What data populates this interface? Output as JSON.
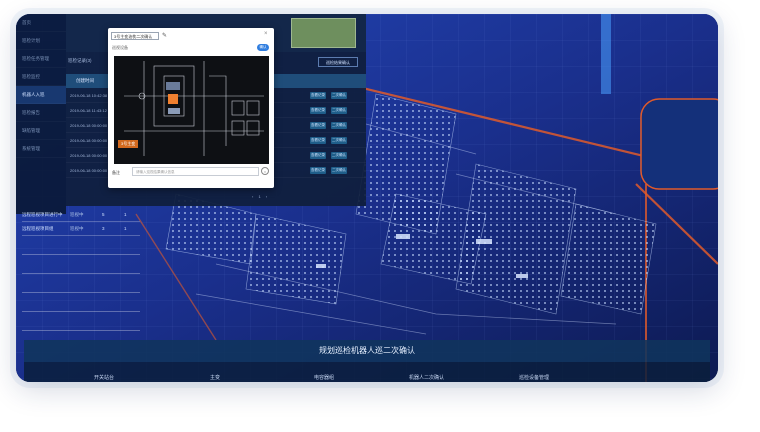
{
  "sidebar": {
    "items": [
      {
        "label": "首页",
        "active": false
      },
      {
        "label": "巡检计划",
        "active": false
      },
      {
        "label": "巡检任务管理",
        "active": false
      },
      {
        "label": "巡检监控",
        "active": false
      },
      {
        "label": "机器人入巡",
        "active": true
      },
      {
        "label": "巡检报告",
        "active": false
      },
      {
        "label": "缺陷管理",
        "active": false
      },
      {
        "label": "系统管理",
        "active": false
      }
    ]
  },
  "background_panel": {
    "section_title": "巡检记录(3)",
    "section_button": "巡检结果确认",
    "table_header": "创建时间",
    "rows": [
      {
        "time": "2019-06-18 10:42:38",
        "btn1": "查看记录",
        "btn2": "二次确认"
      },
      {
        "time": "2019-06-18 11:43:12",
        "btn1": "查看记录",
        "btn2": "二次确认"
      },
      {
        "time": "2019-06-18 00:00:00",
        "btn1": "查看记录",
        "btn2": "二次确认"
      },
      {
        "time": "2019-06-18 00:00:00",
        "btn1": "查看记录",
        "btn2": "二次确认"
      },
      {
        "time": "2019-06-18 00:00:00",
        "btn1": "查看记录",
        "btn2": "二次确认"
      },
      {
        "time": "2019-06-18 00:00:00",
        "btn1": "查看记录",
        "btn2": "二次确认"
      }
    ],
    "pager": "‹ 1 ›"
  },
  "left_list": [
    {
      "name": "远程巡视项目进行中",
      "status": "巡视中",
      "a": "5",
      "b": "1"
    },
    {
      "name": "远程巡视项目组",
      "status": "巡视中",
      "a": "3",
      "b": "1"
    }
  ],
  "dialog": {
    "select_value": "3号主变油枕二次确认",
    "subtitle": "巡视设备",
    "confirm_button": "确认",
    "image_tag": "3号主变",
    "footer_label": "备注",
    "footer_placeholder": "请输入巡视结果确认信息"
  },
  "bottom_bar": {
    "title": "规划巡检机器人巡二次确认",
    "labels": [
      "开关站台",
      "主变",
      "电容器组",
      "机器人二次确认",
      "巡检设备管理"
    ]
  },
  "colors": {
    "scene_dark": "#0a1a3a",
    "accent_blue": "#2f7ddf",
    "road_orange": "#e05a2a",
    "tag_orange": "#d2691e"
  }
}
